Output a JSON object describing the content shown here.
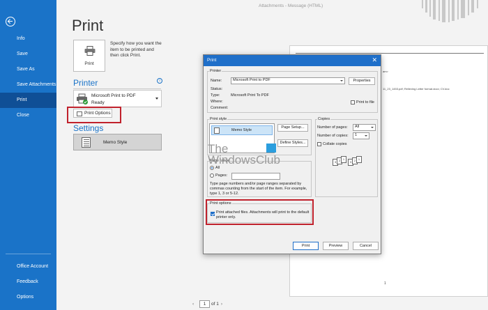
{
  "titlebar": {
    "text": "Attachments - Message (HTML)"
  },
  "sidebar": {
    "items": [
      {
        "label": "Info"
      },
      {
        "label": "Save"
      },
      {
        "label": "Save As"
      },
      {
        "label": "Save Attachments"
      },
      {
        "label": "Print"
      },
      {
        "label": "Close"
      }
    ],
    "bottom": [
      {
        "label": "Office Account"
      },
      {
        "label": "Feedback"
      },
      {
        "label": "Options"
      }
    ],
    "active": "Print",
    "color": "#1a73c8",
    "active_color": "#0f4f96"
  },
  "print_panel": {
    "title": "Print",
    "print_button_label": "Print",
    "description": "Specify how you want the item to be printed and then click Print.",
    "printer_heading": "Printer",
    "printer_name": "Microsoft Print to PDF",
    "printer_status": "Ready",
    "print_options_label": "Print Options",
    "settings_heading": "Settings",
    "settings_style": "Memo Style",
    "info_icon": "i"
  },
  "preview": {
    "line1": "am>",
    "line2": "11_23_1453.pdf; Relieving Letter format.docx; CV.doc",
    "page_dot": "1",
    "pager": {
      "current": "1",
      "total_label": "of 1"
    }
  },
  "dialog": {
    "title": "Print",
    "close": "✕",
    "printer": {
      "group": "Printer",
      "name_label": "Name:",
      "name_value": "Microsoft Print to PDF",
      "properties_label": "Properties",
      "status_label": "Status:",
      "type_label": "Type:",
      "type_value": "Microsoft Print To PDF",
      "where_label": "Where:",
      "comment_label": "Comment:",
      "print_to_file_label": "Print to file"
    },
    "print_style": {
      "group": "Print style",
      "selected": "Memo Style",
      "page_setup_label": "Page Setup...",
      "define_styles_label": "Define Styles..."
    },
    "copies": {
      "group": "Copies",
      "pages_label": "Number of pages:",
      "pages_value": "All",
      "copies_label": "Number of copies:",
      "copies_value": "1",
      "collate_label": "Collate copies"
    },
    "page_range": {
      "group": "Page range",
      "all_label": "All",
      "pages_label": "Pages:",
      "help_text": "Type page numbers and/or page ranges separated by commas counting from the start of the item.  For example, type 1, 3 or 5-12."
    },
    "print_options": {
      "group": "Print options",
      "attached_label": "Print attached files.  Attachments will print to the default printer only.",
      "attached_checked": true
    },
    "buttons": {
      "print": "Print",
      "preview": "Preview",
      "cancel": "Cancel"
    },
    "collate_icons": [
      "3",
      "2",
      "1",
      "3",
      "2",
      "1"
    ]
  },
  "watermark": {
    "line1": "The",
    "line2": "WindowsClub"
  },
  "highlight_color": "#c0212c"
}
